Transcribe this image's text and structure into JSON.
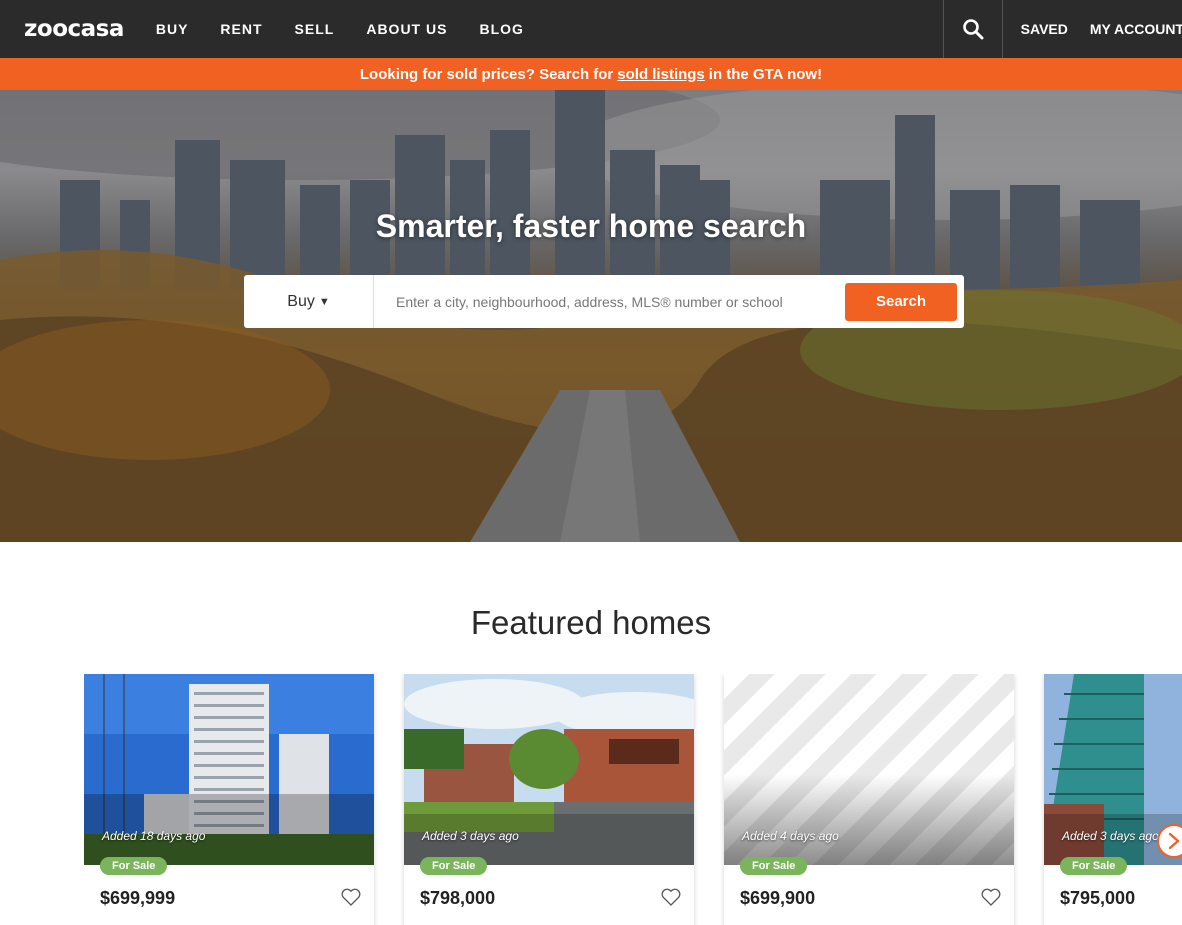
{
  "nav": {
    "logo": "zoocasa",
    "links": [
      "BUY",
      "RENT",
      "SELL",
      "ABOUT US",
      "BLOG"
    ],
    "saved": "SAVED",
    "account": "MY ACCOUNT"
  },
  "banner": {
    "prefix": "Looking for sold prices? Search for",
    "link": "sold listings",
    "suffix": "in the GTA now!"
  },
  "hero": {
    "title": "Smarter, faster home search",
    "mode": "Buy",
    "placeholder": "Enter a city, neighbourhood, address, MLS® number or school",
    "search_button": "Search"
  },
  "featured": {
    "title": "Featured homes",
    "listings": [
      {
        "added": "Added 18 days ago",
        "status": "For Sale",
        "price": "$699,999"
      },
      {
        "added": "Added 3 days ago",
        "status": "For Sale",
        "price": "$798,000"
      },
      {
        "added": "Added 4 days ago",
        "status": "For Sale",
        "price": "$699,900"
      },
      {
        "added": "Added 3 days ago",
        "status": "For Sale",
        "price": "$795,000"
      }
    ]
  },
  "colors": {
    "accent": "#f16122",
    "nav": "#2b2b2b",
    "badge": "#7ab55c"
  },
  "icons": [
    "search-icon",
    "caret-down-icon",
    "heart-icon",
    "chevron-right-icon"
  ]
}
